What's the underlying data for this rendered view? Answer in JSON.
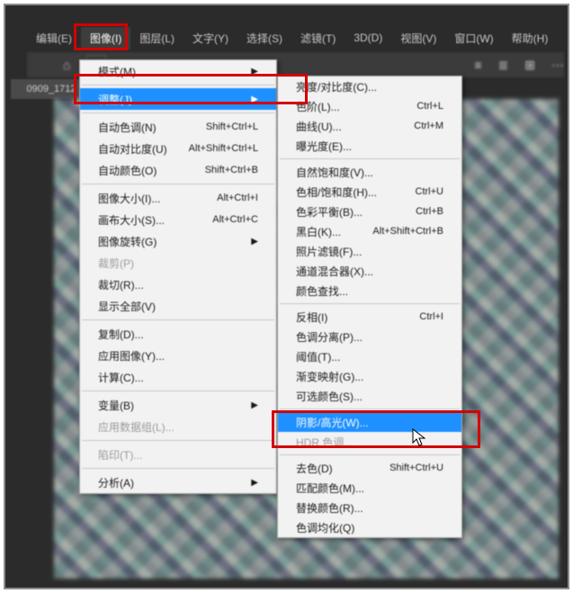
{
  "menubar": {
    "items": [
      {
        "label": "编辑(E)"
      },
      {
        "label": "图像(I)"
      },
      {
        "label": "图层(L)"
      },
      {
        "label": "文字(Y)"
      },
      {
        "label": "选择(S)"
      },
      {
        "label": "滤镜(T)"
      },
      {
        "label": "3D(D)"
      },
      {
        "label": "视图(V)"
      },
      {
        "label": "窗口(W)"
      },
      {
        "label": "帮助(H)"
      }
    ],
    "active_index": 1
  },
  "document_tab": "0909_1712",
  "image_menu": [
    {
      "label": "模式(M)",
      "arrow": true
    },
    {
      "sep": true
    },
    {
      "label": "调整(J)",
      "arrow": true,
      "selected": true
    },
    {
      "sep": true
    },
    {
      "label": "自动色调(N)",
      "shortcut": "Shift+Ctrl+L"
    },
    {
      "label": "自动对比度(U)",
      "shortcut": "Alt+Shift+Ctrl+L"
    },
    {
      "label": "自动颜色(O)",
      "shortcut": "Shift+Ctrl+B"
    },
    {
      "sep": true
    },
    {
      "label": "图像大小(I)...",
      "shortcut": "Alt+Ctrl+I"
    },
    {
      "label": "画布大小(S)...",
      "shortcut": "Alt+Ctrl+C"
    },
    {
      "label": "图像旋转(G)",
      "arrow": true
    },
    {
      "label": "裁剪(P)",
      "disabled": true
    },
    {
      "label": "裁切(R)..."
    },
    {
      "label": "显示全部(V)"
    },
    {
      "sep": true
    },
    {
      "label": "复制(D)..."
    },
    {
      "label": "应用图像(Y)..."
    },
    {
      "label": "计算(C)..."
    },
    {
      "sep": true
    },
    {
      "label": "变量(B)",
      "arrow": true
    },
    {
      "label": "应用数据组(L)...",
      "disabled": true
    },
    {
      "sep": true
    },
    {
      "label": "陷印(T)...",
      "disabled": true
    },
    {
      "sep": true
    },
    {
      "label": "分析(A)",
      "arrow": true
    }
  ],
  "adjust_menu": [
    {
      "label": "亮度/对比度(C)..."
    },
    {
      "label": "色阶(L)...",
      "shortcut": "Ctrl+L"
    },
    {
      "label": "曲线(U)...",
      "shortcut": "Ctrl+M"
    },
    {
      "label": "曝光度(E)..."
    },
    {
      "sep": true
    },
    {
      "label": "自然饱和度(V)..."
    },
    {
      "label": "色相/饱和度(H)...",
      "shortcut": "Ctrl+U"
    },
    {
      "label": "色彩平衡(B)...",
      "shortcut": "Ctrl+B"
    },
    {
      "label": "黑白(K)...",
      "shortcut": "Alt+Shift+Ctrl+B"
    },
    {
      "label": "照片滤镜(F)..."
    },
    {
      "label": "通道混合器(X)..."
    },
    {
      "label": "颜色查找..."
    },
    {
      "sep": true
    },
    {
      "label": "反相(I)",
      "shortcut": "Ctrl+I"
    },
    {
      "label": "色调分离(P)..."
    },
    {
      "label": "阈值(T)..."
    },
    {
      "label": "渐变映射(G)..."
    },
    {
      "label": "可选颜色(S)..."
    },
    {
      "sep": true
    },
    {
      "label": "阴影/高光(W)...",
      "selected": true
    },
    {
      "label": "HDR 色调...",
      "disabled": true
    },
    {
      "sep": true
    },
    {
      "label": "去色(D)",
      "shortcut": "Shift+Ctrl+U"
    },
    {
      "label": "匹配颜色(M)..."
    },
    {
      "label": "替换颜色(R)..."
    },
    {
      "label": "色调均化(Q)"
    }
  ],
  "highlights": {
    "menubar": "图像(I)",
    "submenu1": "调整(J)",
    "submenu2": "阴影/高光(W)..."
  }
}
